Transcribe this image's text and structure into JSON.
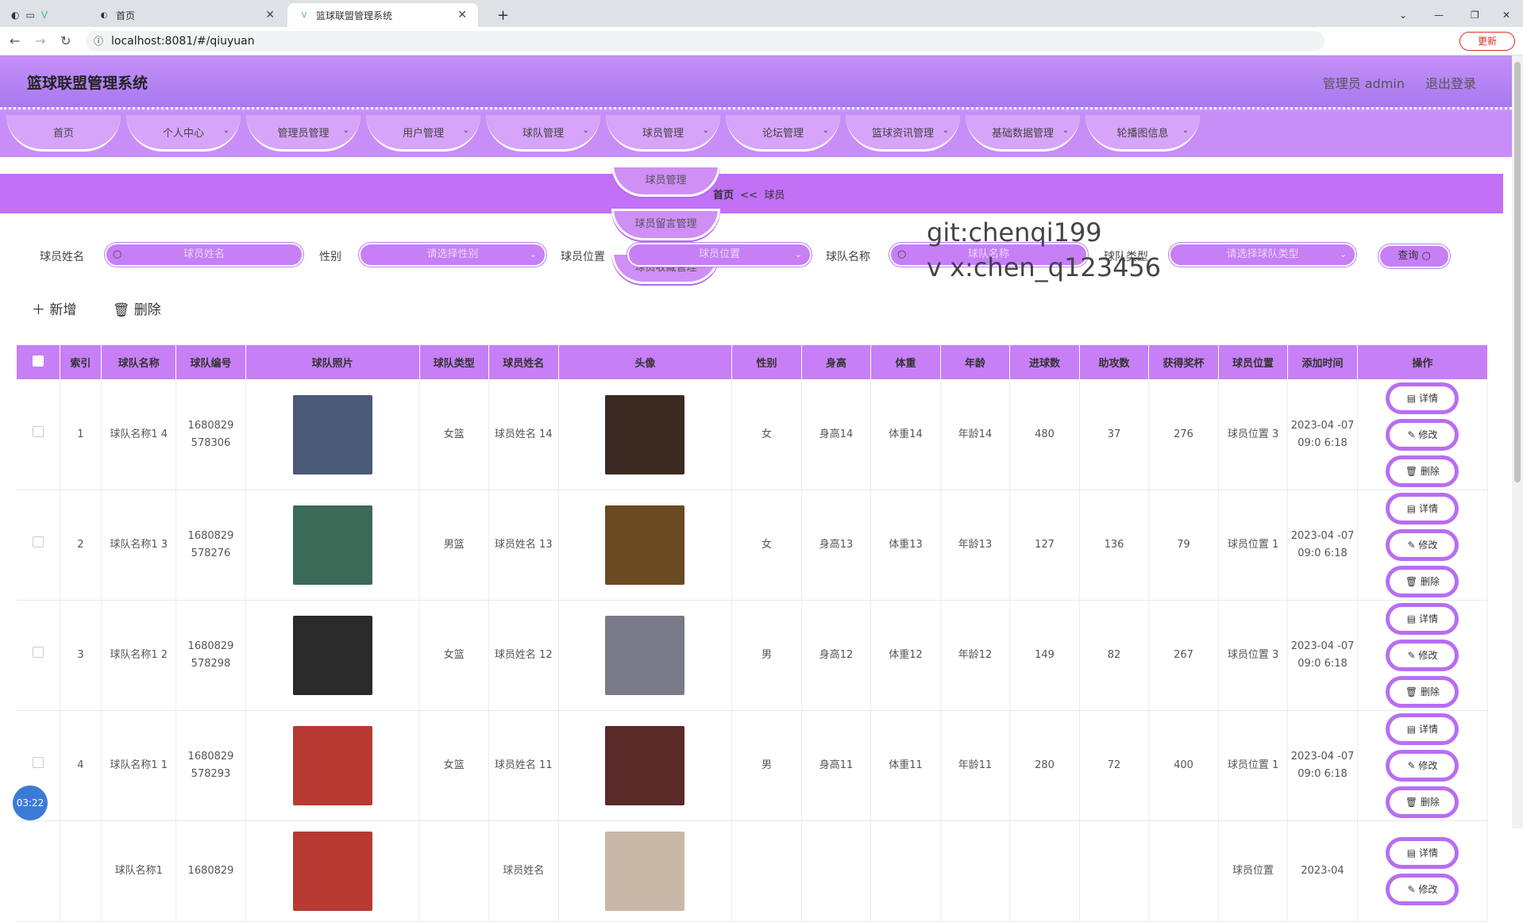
{
  "browser": {
    "tabs": [
      {
        "label": "首页"
      },
      {
        "label": "篮球联盟管理系统"
      }
    ],
    "url": "localhost:8081/#/qiuyuan",
    "update_label": "更新"
  },
  "header": {
    "title": "篮球联盟管理系统",
    "user": "管理员 admin",
    "logout": "退出登录"
  },
  "menu": [
    {
      "label": "首页",
      "has_chevron": false
    },
    {
      "label": "个人中心",
      "has_chevron": true
    },
    {
      "label": "管理员管理",
      "has_chevron": true
    },
    {
      "label": "用户管理",
      "has_chevron": true
    },
    {
      "label": "球队管理",
      "has_chevron": true
    },
    {
      "label": "球员管理",
      "has_chevron": true
    },
    {
      "label": "论坛管理",
      "has_chevron": true
    },
    {
      "label": "篮球资讯管理",
      "has_chevron": true
    },
    {
      "label": "基础数据管理",
      "has_chevron": true
    },
    {
      "label": "轮播图信息",
      "has_chevron": true
    }
  ],
  "dropdown": [
    "球员管理",
    "球员留言管理",
    "球员收藏管理"
  ],
  "breadcrumb": {
    "home": "首页",
    "sep": "<<",
    "current": "球员"
  },
  "search": {
    "player_name_label": "球员姓名",
    "player_name_placeholder": "球员姓名",
    "gender_label": "性别",
    "gender_placeholder": "请选择性别",
    "position_label": "球员位置",
    "position_placeholder": "球员位置",
    "team_name_label": "球队名称",
    "team_name_placeholder": "球队名称",
    "team_type_label": "球队类型",
    "team_type_placeholder": "请选择球队类型",
    "query_label": "查询"
  },
  "watermark": [
    "git:chenqi199",
    "v x:chen_q123456"
  ],
  "toolbar": {
    "add": "＋ 新增",
    "delete": "🗑 删除"
  },
  "table": {
    "headers": [
      "索引",
      "球队名称",
      "球队编号",
      "球队照片",
      "球队类型",
      "球员姓名",
      "头像",
      "性别",
      "身高",
      "体重",
      "年龄",
      "进球数",
      "助攻数",
      "获得奖杯",
      "球员位置",
      "添加时间",
      "操作"
    ],
    "rows": [
      {
        "index": "1",
        "team_name": "球队名称1 4",
        "team_no": "1680829 578306",
        "team_type": "女篮",
        "player": "球员姓名 14",
        "gender": "女",
        "height": "身高14",
        "weight": "体重14",
        "age": "年龄14",
        "goals": "480",
        "assists": "37",
        "trophies": "276",
        "position": "球员位置 3",
        "added": "2023-04 -07 09:0 6:18",
        "photo_color": "#4a5a78",
        "avatar_color": "#3a2a22"
      },
      {
        "index": "2",
        "team_name": "球队名称1 3",
        "team_no": "1680829 578276",
        "team_type": "男篮",
        "player": "球员姓名 13",
        "gender": "女",
        "height": "身高13",
        "weight": "体重13",
        "age": "年龄13",
        "goals": "127",
        "assists": "136",
        "trophies": "79",
        "position": "球员位置 1",
        "added": "2023-04 -07 09:0 6:18",
        "photo_color": "#3a6a58",
        "avatar_color": "#6a4a20"
      },
      {
        "index": "3",
        "team_name": "球队名称1 2",
        "team_no": "1680829 578298",
        "team_type": "女篮",
        "player": "球员姓名 12",
        "gender": "男",
        "height": "身高12",
        "weight": "体重12",
        "age": "年龄12",
        "goals": "149",
        "assists": "82",
        "trophies": "267",
        "position": "球员位置 3",
        "added": "2023-04 -07 09:0 6:18",
        "photo_color": "#2a2a2a",
        "avatar_color": "#7a7a88"
      },
      {
        "index": "4",
        "team_name": "球队名称1 1",
        "team_no": "1680829 578293",
        "team_type": "女篮",
        "player": "球员姓名 11",
        "gender": "男",
        "height": "身高11",
        "weight": "体重11",
        "age": "年龄11",
        "goals": "280",
        "assists": "72",
        "trophies": "400",
        "position": "球员位置 1",
        "added": "2023-04 -07 09:0 6:18",
        "photo_color": "#b83a32",
        "avatar_color": "#5a2a28"
      },
      {
        "index": "",
        "team_name": "球队名称1",
        "team_no": "1680829",
        "team_type": "",
        "player": "球员姓名",
        "gender": "",
        "height": "",
        "weight": "",
        "age": "",
        "goals": "",
        "assists": "",
        "trophies": "",
        "position": "球员位置",
        "added": "2023-04",
        "photo_color": "#b83a32",
        "avatar_color": "#c9b8a8"
      }
    ],
    "ops": {
      "detail": "详情",
      "edit": "修改",
      "remove": "删除"
    }
  },
  "timer": "03:22"
}
